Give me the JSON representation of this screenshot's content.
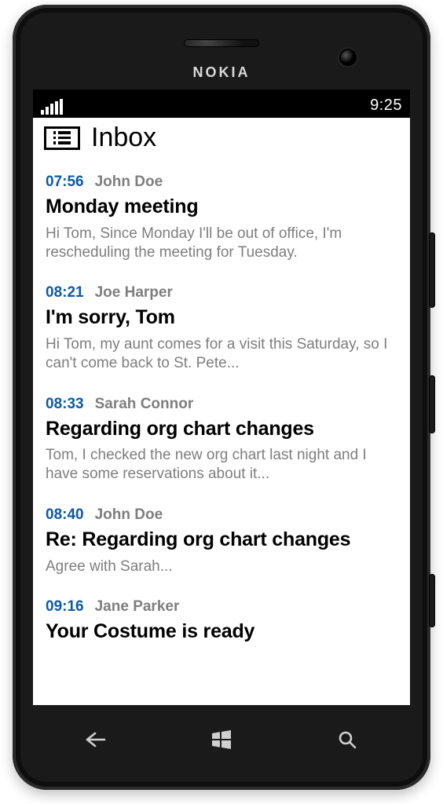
{
  "device": {
    "brand": "NOKIA"
  },
  "status": {
    "clock": "9:25"
  },
  "header": {
    "title": "Inbox"
  },
  "messages": [
    {
      "time": "07:56",
      "sender": "John Doe",
      "subject": "Monday meeting",
      "preview": "Hi Tom, Since Monday I'll be out of office, I'm rescheduling the meeting for Tuesday."
    },
    {
      "time": "08:21",
      "sender": "Joe Harper",
      "subject": "I'm sorry, Tom",
      "preview": "Hi Tom, my aunt comes for a visit this Saturday, so I can't come back to St. Pete..."
    },
    {
      "time": "08:33",
      "sender": "Sarah Connor",
      "subject": "Regarding org chart changes",
      "preview": "Tom, I checked the new org chart last night and I have some reservations about it..."
    },
    {
      "time": "08:40",
      "sender": "John Doe",
      "subject": "Re: Regarding org chart changes",
      "preview": "Agree with Sarah..."
    },
    {
      "time": "09:16",
      "sender": "Jane Parker",
      "subject": "Your Costume is ready",
      "preview": ""
    }
  ]
}
